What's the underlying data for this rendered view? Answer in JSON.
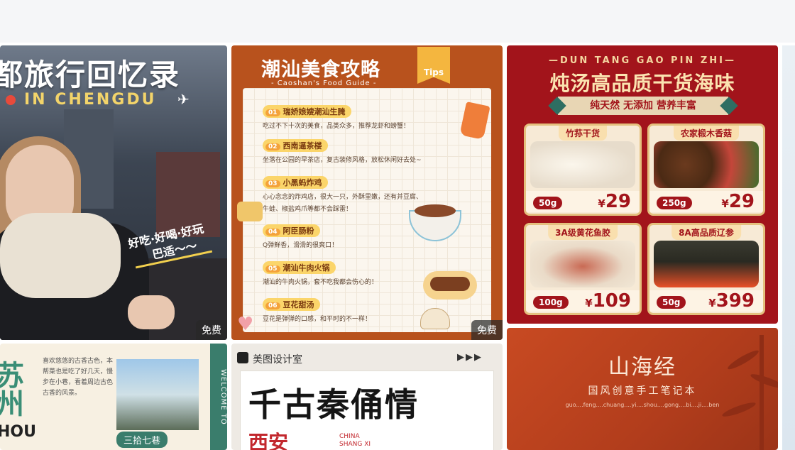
{
  "cards": [
    {
      "title": "都旅行回忆录",
      "subtitle": "IN CHENGDU",
      "slogan_line1": "好吃·好喝·好玩",
      "slogan_line2": "巴适～～",
      "badge": "免费"
    },
    {
      "title": "潮汕美食攻略",
      "guide": "- Caoshan's Food Guide -",
      "tips": "Tips",
      "items": [
        {
          "num": "01",
          "name": "瑞娇娘嫂潮汕生腌",
          "desc": "吃过不下十次的美食，品类众多，推荐龙虾和螃蟹！"
        },
        {
          "num": "02",
          "name": "西南逼茶楼",
          "desc": "坐落在公园的早茶店，复古装修风格，放松休闲好去处~"
        },
        {
          "num": "03",
          "name": "小黑蚂炸鸡",
          "desc": "心心念念的炸鸡店，很大一只，外酥里嫩，还有并豆腐、"
        },
        {
          "num": "04",
          "name": "阿臣肠粉",
          "desc": "Q弹鲜香，滑滑的很爽口！"
        },
        {
          "num": "05",
          "name": "潮汕牛肉火锅",
          "desc": "潮汕的牛肉火锅，套不吃我都会伤心的！"
        },
        {
          "num": "06",
          "name": "豆花甜汤",
          "desc": "豆花是弹弹的口感，和平时的不一样！"
        }
      ],
      "item3_desc2": "牛蛙、椒盐鸡爪等都不会踩雷！",
      "badge": "免费"
    },
    {
      "top": "—DUN TANG GAO PIN ZHI—",
      "title": "炖汤高品质干货海味",
      "ribbon": "纯天然 无添加 营养丰富",
      "products": [
        {
          "label": "竹荪干货",
          "weight": "50g",
          "price": "29"
        },
        {
          "label": "农家椴木香菇",
          "weight": "250g",
          "price": "29"
        },
        {
          "label": "3A级黄花鱼胶",
          "weight": "100g",
          "price": "109"
        },
        {
          "label": "8A高品质辽参",
          "weight": "50g",
          "price": "399"
        }
      ],
      "currency": "¥"
    },
    {
      "big": "苏\n州",
      "hou": "HOU",
      "welcome": "WELCOME TO",
      "handwriting": "喜欢悠悠的古香古色，本帮菜也是吃了好几天，慢步在小巷，看着周边古色古香的风景。",
      "tag": "三拾七巷"
    },
    {
      "brand": "美图设计室",
      "arrows": "▶▶▶",
      "title": "千古秦俑情",
      "sub": "西安",
      "china1": "CHINA",
      "china2": "SHANG XI"
    },
    {
      "title": "山海经",
      "sub": "国风创意手工笔记本",
      "pinyin": "guo....feng....chuang....yi....shou....gong....bi....ji....ben"
    }
  ],
  "colors": {
    "food_bg": "#b8521d",
    "seafood_bg": "#a2141b",
    "shanhai_bg": "#c84a22"
  }
}
